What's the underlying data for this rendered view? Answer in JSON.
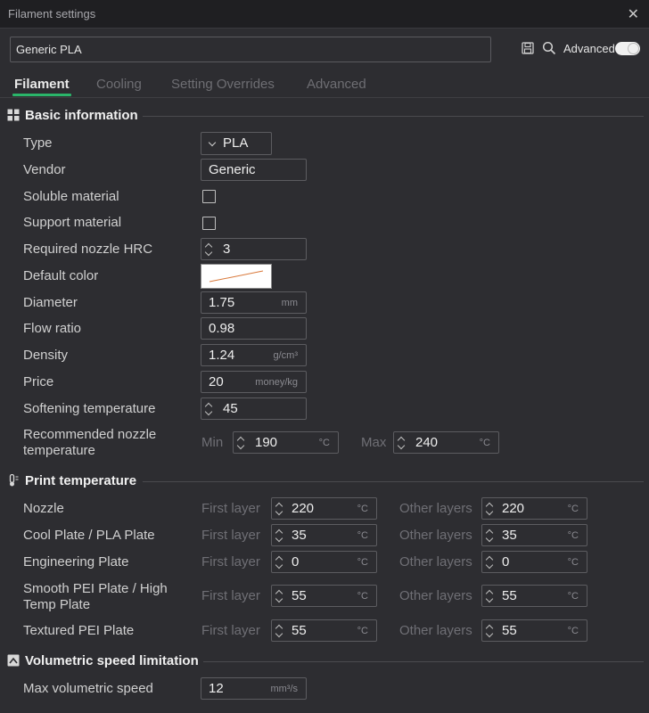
{
  "window": {
    "title": "Filament settings"
  },
  "preset": {
    "name": "Generic PLA"
  },
  "header": {
    "advanced_label": "Advanced",
    "advanced_enabled": true
  },
  "tabs": [
    {
      "label": "Filament",
      "active": true
    },
    {
      "label": "Cooling",
      "active": false
    },
    {
      "label": "Setting Overrides",
      "active": false
    },
    {
      "label": "Advanced",
      "active": false
    }
  ],
  "basic": {
    "title": "Basic information",
    "type": {
      "label": "Type",
      "value": "PLA"
    },
    "vendor": {
      "label": "Vendor",
      "value": "Generic"
    },
    "soluble": {
      "label": "Soluble material",
      "checked": false
    },
    "support": {
      "label": "Support material",
      "checked": false
    },
    "hrc": {
      "label": "Required nozzle HRC",
      "value": "3"
    },
    "color": {
      "label": "Default color",
      "value": "#ffffff"
    },
    "diameter": {
      "label": "Diameter",
      "value": "1.75",
      "unit": "mm"
    },
    "flow": {
      "label": "Flow ratio",
      "value": "0.98"
    },
    "density": {
      "label": "Density",
      "value": "1.24",
      "unit": "g/cm³"
    },
    "price": {
      "label": "Price",
      "value": "20",
      "unit": "money/kg"
    },
    "softening": {
      "label": "Softening temperature",
      "value": "45"
    },
    "nozzle_temp": {
      "label_line1": "Recommended nozzle",
      "label_line2": "temperature",
      "min_label": "Min",
      "min_value": "190",
      "min_unit": "°C",
      "max_label": "Max",
      "max_value": "240",
      "max_unit": "°C"
    }
  },
  "print_temp": {
    "title": "Print temperature",
    "first_label": "First layer",
    "other_label": "Other layers",
    "unit": "°C",
    "rows": [
      {
        "label": "Nozzle",
        "first": "220",
        "other": "220"
      },
      {
        "label": "Cool Plate / PLA Plate",
        "first": "35",
        "other": "35"
      },
      {
        "label": "Engineering Plate",
        "first": "0",
        "other": "0"
      },
      {
        "label_line1": "Smooth PEI Plate / High",
        "label_line2": "Temp Plate",
        "first": "55",
        "other": "55"
      },
      {
        "label": "Textured PEI Plate",
        "first": "55",
        "other": "55"
      }
    ]
  },
  "volumetric": {
    "title": "Volumetric speed limitation",
    "max": {
      "label": "Max volumetric speed",
      "value": "12",
      "unit": "mm³/s"
    }
  }
}
